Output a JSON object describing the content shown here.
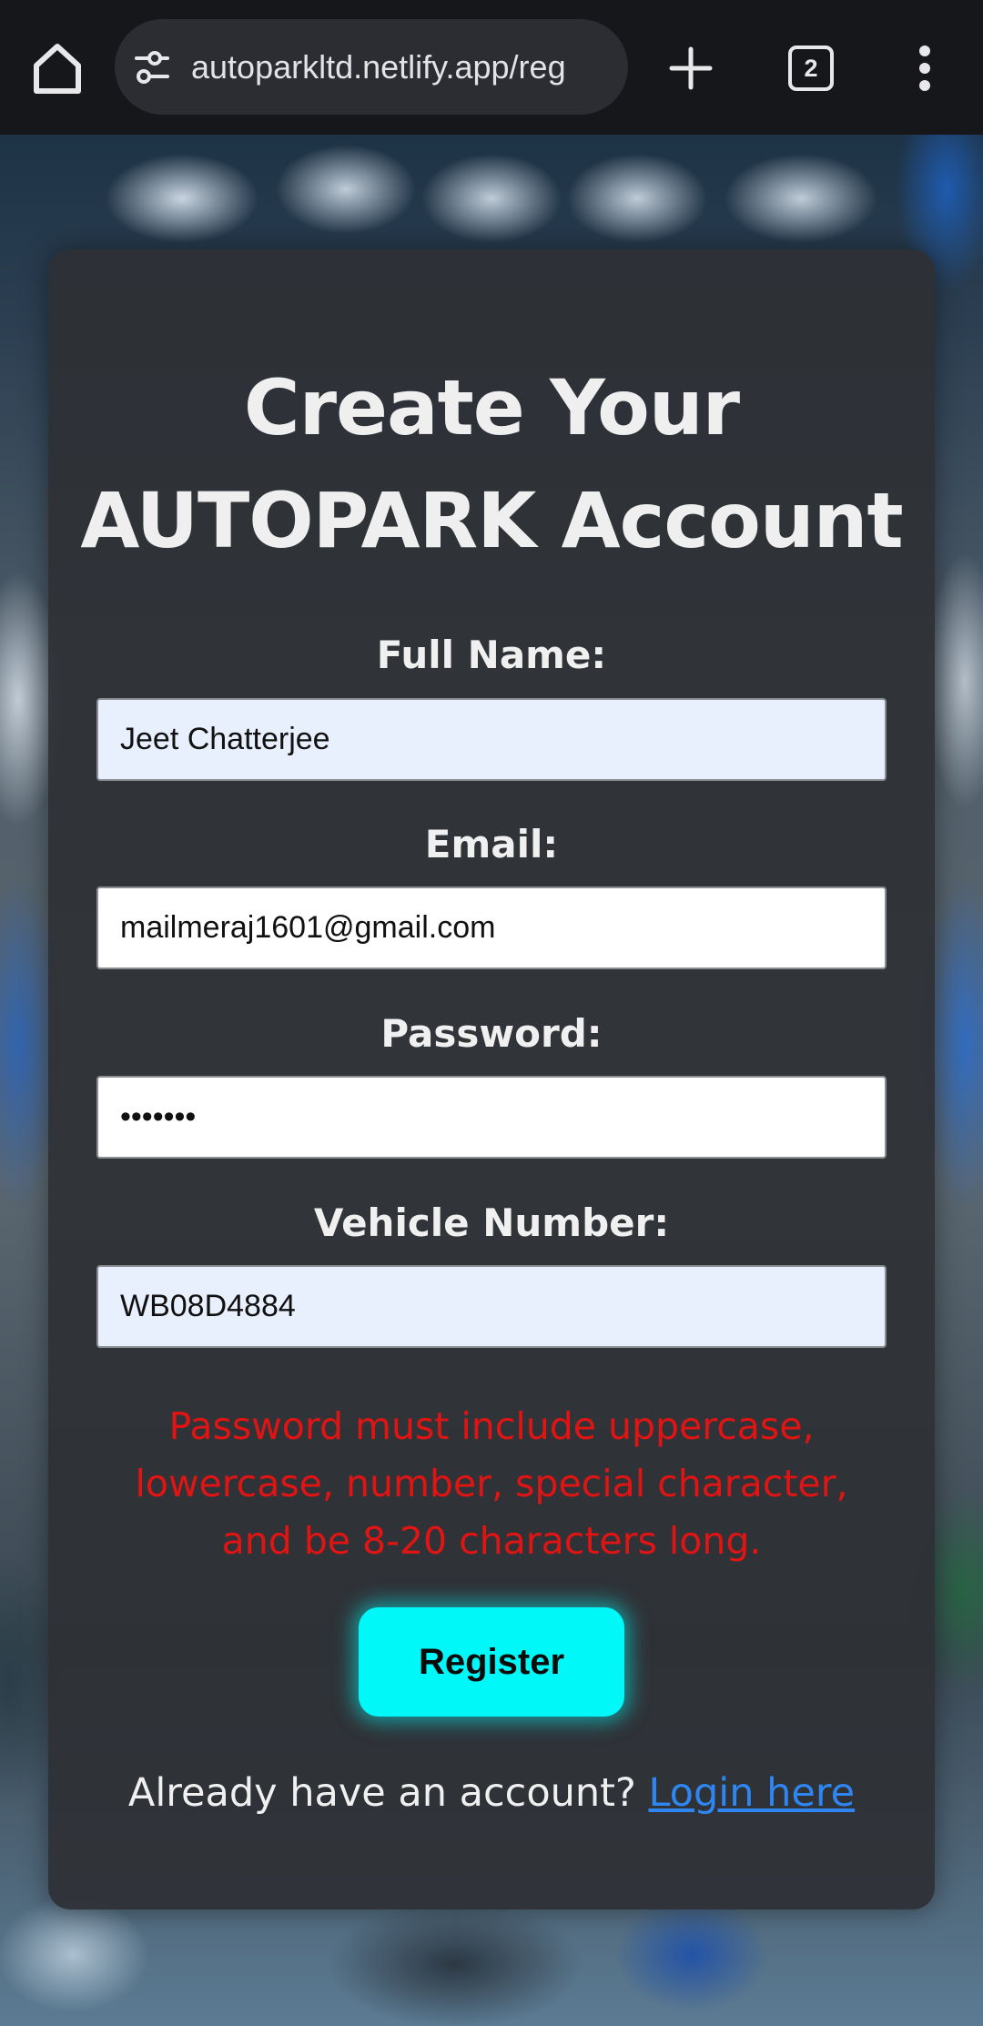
{
  "browser": {
    "url": "autoparkltd.netlify.app/reg",
    "tab_count": "2",
    "icons": {
      "home": "home-icon",
      "site_settings": "tune-icon",
      "new_tab": "plus-icon",
      "tabs": "tab-switcher-icon",
      "menu": "more-vert-icon"
    }
  },
  "form": {
    "title_line1": "Create Your",
    "title_line2": "AUTOPARK Account",
    "full_name_label": "Full Name:",
    "full_name_value": "Jeet Chatterjee",
    "email_label": "Email:",
    "email_value": "mailmeraj1601@gmail.com",
    "password_label": "Password:",
    "password_value": "•••••••",
    "vehicle_label": "Vehicle Number:",
    "vehicle_value": "WB08D4884",
    "error_message": "Password must include uppercase,\nlowercase, number, special character,\nand be 8-20 characters long.",
    "register_label": "Register",
    "login_prompt": "Already have an account?",
    "login_link": "Login here"
  },
  "colors": {
    "accent_button": "#00f8f8",
    "error_text": "#e11414",
    "link": "#2f86f0",
    "autofill_bg": "#e8effd"
  }
}
